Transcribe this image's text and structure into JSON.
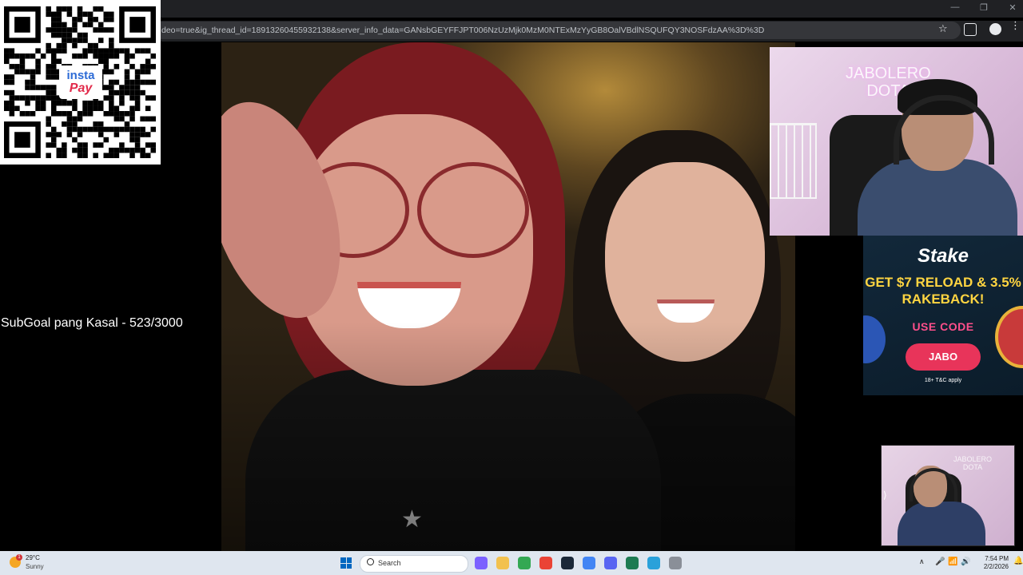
{
  "browser": {
    "url": "deo=true&ig_thread_id=18913260455932138&server_info_data=GANsbGEYFFJPT006NzUzMjk0MzM0NTExMzYyGB8OalVBdlNSQUFQY3NOSFdzAA%3D%3D",
    "window_controls": {
      "minimize": "—",
      "restore": "❐",
      "close": "✕"
    },
    "star": "☆",
    "menu": "⋮"
  },
  "overlay": {
    "qr_logo_line1": "insta",
    "qr_logo_line2": "Pay",
    "subgoal": "SubGoal pang Kasal - 523/3000"
  },
  "video": {
    "pendant": "★"
  },
  "cam_top": {
    "neon_text": "JABOLERO\nDOTA"
  },
  "ad": {
    "logo": "Stake",
    "headline": "GET $7 RELOAD & 3.5% RAKEBACK!",
    "use_code": "USE CODE",
    "code": "JABO",
    "terms": "18+  T&C apply"
  },
  "cam_bottom": {
    "neon_text": "JABOLERO\nDOTA",
    "expand": "⟩"
  },
  "taskbar": {
    "weather_badge": "1",
    "temp": "29°C",
    "condition": "Sunny",
    "search_placeholder": "Search",
    "tray_chevron": "∧",
    "mic": "🎤",
    "wifi": "📶",
    "speaker": "🔊",
    "time": "7:54 PM",
    "date": "2/2/2026",
    "notifications": "🔔",
    "colors": {
      "accent": "#0067c0",
      "background": "#dfe6ef"
    },
    "apps": [
      {
        "name": "copilot-icon",
        "color": "#7b61ff"
      },
      {
        "name": "file-explorer-icon",
        "color": "#f2c14e"
      },
      {
        "name": "chrome-icon",
        "color": "#34a853"
      },
      {
        "name": "chrome-icon",
        "color": "#ea4335"
      },
      {
        "name": "steam-icon",
        "color": "#1b2838"
      },
      {
        "name": "chrome-icon",
        "color": "#4285f4"
      },
      {
        "name": "discord-icon",
        "color": "#5865f2"
      },
      {
        "name": "terminal-icon",
        "color": "#1d7b52"
      },
      {
        "name": "telegram-icon",
        "color": "#2aa1da"
      },
      {
        "name": "app-icon",
        "color": "#8a8f98"
      }
    ]
  }
}
